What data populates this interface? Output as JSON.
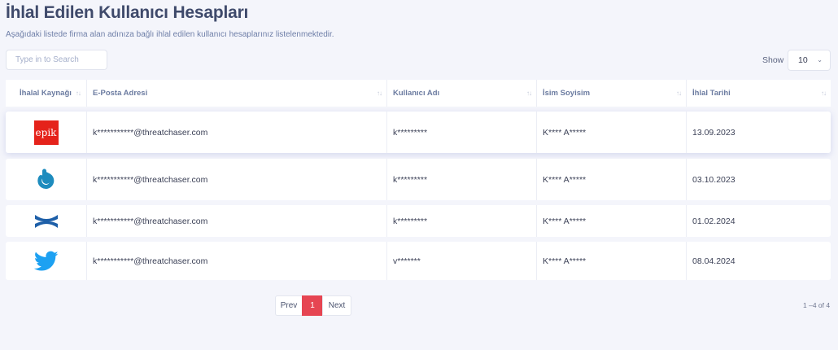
{
  "page": {
    "title": "İhlal Edilen Kullanıcı Hesapları",
    "subtitle": "Aşağıdaki listede firma alan adınıza bağlı ihlal edilen kullanıcı hesaplarınız listelenmektedir."
  },
  "search": {
    "placeholder": "Type in to Search",
    "value": ""
  },
  "show": {
    "label": "Show",
    "value": "10"
  },
  "table": {
    "headers": [
      "İhalal Kaynağı",
      "E-Posta Adresi",
      "Kullanıcı Adı",
      "İsim Soyisim",
      "İhlal Tarihi"
    ],
    "sort_glyph": "↑↓",
    "rows": [
      {
        "source_icon": "epik-logo-icon",
        "source_text": "epik",
        "email": "k***********@threatchaser.com",
        "username": "k*********",
        "name": "K**** A*****",
        "date": "13.09.2023"
      },
      {
        "source_icon": "gravatar-logo-icon",
        "email": "k***********@threatchaser.com",
        "username": "k*********",
        "name": "K**** A*****",
        "date": "03.10.2023"
      },
      {
        "source_icon": "under-armour-logo-icon",
        "email": "k***********@threatchaser.com",
        "username": "k*********",
        "name": "K**** A*****",
        "date": "01.02.2024"
      },
      {
        "source_icon": "twitter-logo-icon",
        "email": "k***********@threatchaser.com",
        "username": "v*******",
        "name": "K**** A*****",
        "date": "08.04.2024"
      }
    ]
  },
  "pagination": {
    "prev": "Prev",
    "current": "1",
    "next": "Next",
    "count": "1 –4 of 4"
  },
  "colors": {
    "accent": "#e64552",
    "epik": "#e5231b",
    "gravatar": "#1e8cbe",
    "under_armour": "#1d5fa8",
    "twitter": "#1da1f2"
  }
}
